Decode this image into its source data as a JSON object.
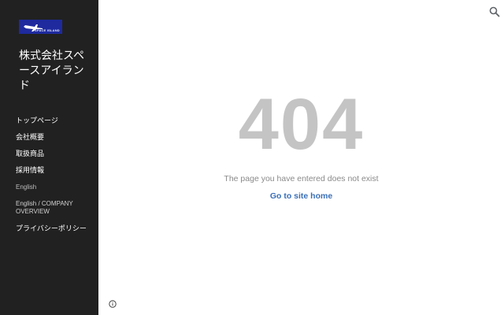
{
  "sidebar": {
    "logo_text": "SPACE ISLAND",
    "site_title": "株式会社スペースアイランド",
    "items": [
      {
        "label": "トップページ"
      },
      {
        "label": "会社概要"
      },
      {
        "label": "取扱商品"
      },
      {
        "label": "採用情報"
      },
      {
        "label": "English"
      },
      {
        "label": "English / COMPANY OVERVIEW"
      },
      {
        "label": "プライバシーポリシー"
      }
    ]
  },
  "main": {
    "error_code": "404",
    "message": "The page you have entered does not exist",
    "home_link": "Go to site home"
  },
  "colors": {
    "sidebar_bg": "#212121",
    "error_text": "#c4c4c4",
    "link": "#3a6fb7",
    "logo_bg": "#1e2a9e"
  },
  "icons": {
    "search": "search-icon",
    "info": "info-icon"
  }
}
